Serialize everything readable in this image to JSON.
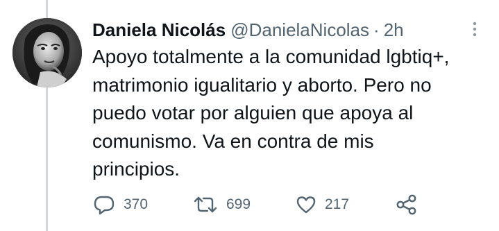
{
  "tweet": {
    "author": {
      "display_name": "Daniela Nicolás",
      "handle": "@DanielaNicolas"
    },
    "separator": "·",
    "time": "2h",
    "text_lines": [
      "Apoyo totalmente a la comunidad lgbtiq+,",
      "matrimonio igualitario y aborto. Pero no",
      "puedo votar por alguien que apoya al",
      "comunismo. Va en contra de mis",
      "principios."
    ],
    "metrics": {
      "replies": "370",
      "retweets": "699",
      "likes": "217"
    }
  },
  "icons": {
    "more": "more-dots-icon",
    "reply": "reply-icon",
    "retweet": "retweet-icon",
    "like": "heart-icon",
    "share": "share-icon"
  },
  "colors": {
    "text_primary": "#0f1419",
    "text_secondary": "#536471",
    "thread_line": "#cfd9de"
  }
}
